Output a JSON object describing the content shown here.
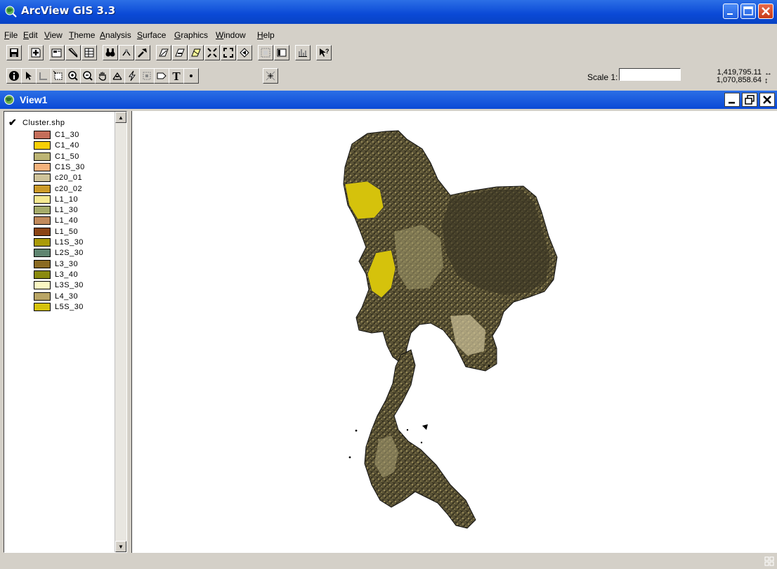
{
  "window": {
    "title": "ArcView GIS 3.3"
  },
  "menu": [
    "File",
    "Edit",
    "View",
    "Theme",
    "Analysis",
    "Surface",
    "Graphics",
    "Window",
    "Help"
  ],
  "toolbar": {
    "scale_label": "Scale 1:",
    "scale_value": "",
    "coord_x": "1,419,795.11",
    "coord_y": "1,070,858.64",
    "text_tool": "T",
    "help_tool": "?"
  },
  "view": {
    "title": "View1"
  },
  "toc": {
    "theme_name": "Cluster.shp",
    "theme_visible": true,
    "legend": [
      {
        "label": "C1_30",
        "color": "#c46e5a"
      },
      {
        "label": "C1_40",
        "color": "#f7cf05"
      },
      {
        "label": "C1_50",
        "color": "#bcb474"
      },
      {
        "label": "C1S_30",
        "color": "#f4b27c"
      },
      {
        "label": "c20_01",
        "color": "#cfc39a"
      },
      {
        "label": "c20_02",
        "color": "#cc9a28"
      },
      {
        "label": "L1_10",
        "color": "#f4e890"
      },
      {
        "label": "L1_30",
        "color": "#a5ab6a"
      },
      {
        "label": "L1_40",
        "color": "#c18a5c"
      },
      {
        "label": "L1_50",
        "color": "#8b4515"
      },
      {
        "label": "L1S_30",
        "color": "#aa9a08"
      },
      {
        "label": "L2S_30",
        "color": "#5f8570"
      },
      {
        "label": "L3_30",
        "color": "#8a6a22"
      },
      {
        "label": "L3_40",
        "color": "#8a8a0e"
      },
      {
        "label": "L3S_30",
        "color": "#fbf7c2"
      },
      {
        "label": "L4_30",
        "color": "#b9a565"
      },
      {
        "label": "L5S_30",
        "color": "#d5c20c"
      }
    ]
  }
}
